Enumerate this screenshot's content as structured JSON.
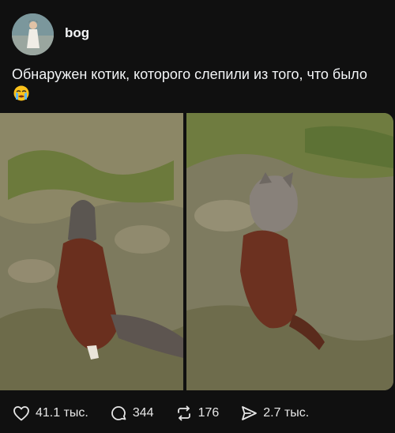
{
  "post": {
    "username": "bog",
    "text": "Обнаружен котик, которого слепили из того, что было",
    "emoji_icon": "loudly-crying-face-icon"
  },
  "media": [
    {
      "alt_icon": "cat-photo",
      "index": 1
    },
    {
      "alt_icon": "cat-photo",
      "index": 2
    }
  ],
  "actions": {
    "likes": "41.1 тыс.",
    "replies": "344",
    "reposts": "176",
    "shares": "2.7 тыс."
  },
  "colors": {
    "background": "#101010",
    "text": "#f3f5f7"
  }
}
